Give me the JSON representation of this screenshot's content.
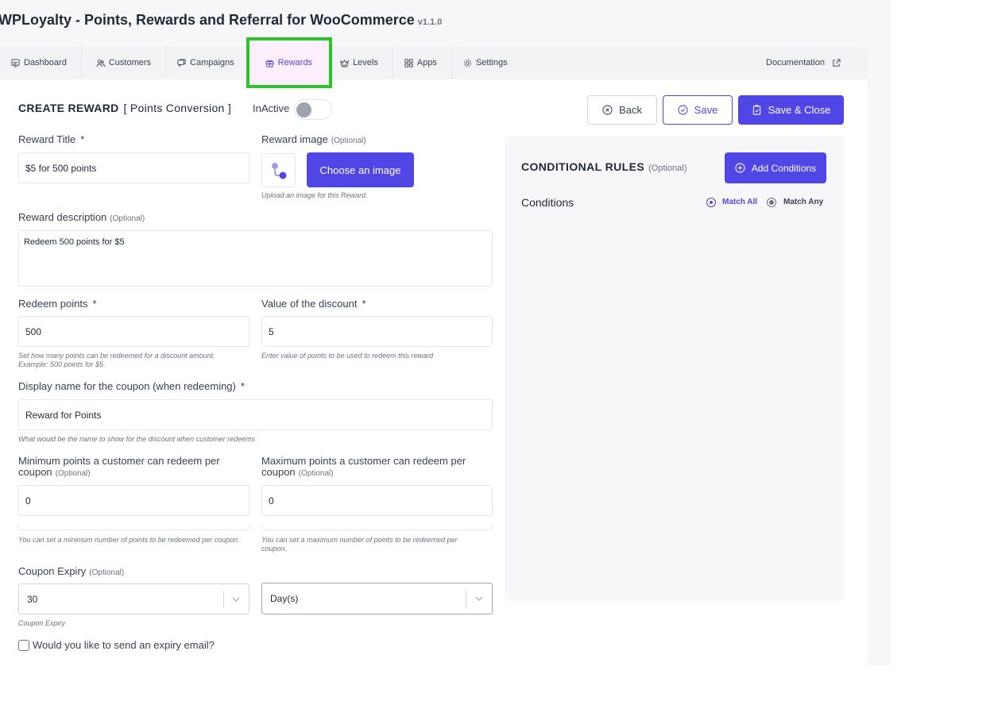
{
  "app": {
    "title": "WPLoyalty - Points, Rewards and Referral for WooCommerce",
    "version": "v1.1.0"
  },
  "tabs": [
    {
      "label": "Dashboard",
      "icon": "dashboard-icon"
    },
    {
      "label": "Customers",
      "icon": "users-icon"
    },
    {
      "label": "Campaigns",
      "icon": "chat-icon"
    },
    {
      "label": "Rewards",
      "icon": "gift-icon",
      "active": true
    },
    {
      "label": "Levels",
      "icon": "crown-icon"
    },
    {
      "label": "Apps",
      "icon": "grid-icon"
    },
    {
      "label": "Settings",
      "icon": "gear-icon"
    }
  ],
  "documentation": {
    "label": "Documentation",
    "icon": "external-link-icon"
  },
  "header": {
    "heading": "CREATE REWARD",
    "subheading": "[ Points Conversion ]",
    "status": "InActive",
    "active": false
  },
  "actions": {
    "back": "Back",
    "save": "Save",
    "save_close": "Save & Close"
  },
  "form": {
    "reward_title": {
      "label": "Reward Title",
      "required": "*",
      "value": "$5 for 500 points"
    },
    "reward_image": {
      "label": "Reward image",
      "optional": "(Optional)",
      "button": "Choose an image",
      "hint": "Upload an image for this Reward."
    },
    "reward_description": {
      "label": "Reward description",
      "optional": "(Optional)",
      "value": "Redeem 500 points for $5"
    },
    "redeem_points": {
      "label": "Redeem points",
      "required": "*",
      "value": "500",
      "hint_1": "Set how many points can be redeemed for a discount amount.",
      "hint_2": "Example: 500 points for $5."
    },
    "discount_value": {
      "label": "Value of the discount",
      "required": "*",
      "value": "5",
      "hint": "Enter value of points to be used to redeem this reward"
    },
    "coupon_display_name": {
      "label": "Display name for the coupon (when redeeming)",
      "required": "*",
      "value": "Reward for Points",
      "hint": "What would be the name to show for the discount when customer redeems"
    },
    "min_points": {
      "label": "Minimum points a customer can redeem per coupon",
      "optional": "(Optional)",
      "value": "0",
      "hint": "You can set a minimum number of points to be redeemed per coupon."
    },
    "max_points": {
      "label": "Maximum points a customer can redeem per coupon",
      "optional": "(Optional)",
      "value": "0",
      "hint": "You can set a maximum number of points to be redeemed per coupon."
    },
    "coupon_expiry": {
      "label": "Coupon Expiry",
      "optional": "(Optional)",
      "value": "30",
      "unit": "Day(s)",
      "hint": "Coupon Expiry"
    },
    "expiry_email": {
      "label": "Would you like to send an expiry email?",
      "checked": false
    }
  },
  "conditional_rules": {
    "title": "CONDITIONAL RULES",
    "optional": "(Optional)",
    "add_button": "Add Conditions",
    "conditions_label": "Conditions",
    "match_all": "Match All",
    "match_any": "Match Any",
    "selected": "Match All"
  },
  "colors": {
    "primary": "#4f46e5",
    "highlight": "#2bc52b"
  }
}
